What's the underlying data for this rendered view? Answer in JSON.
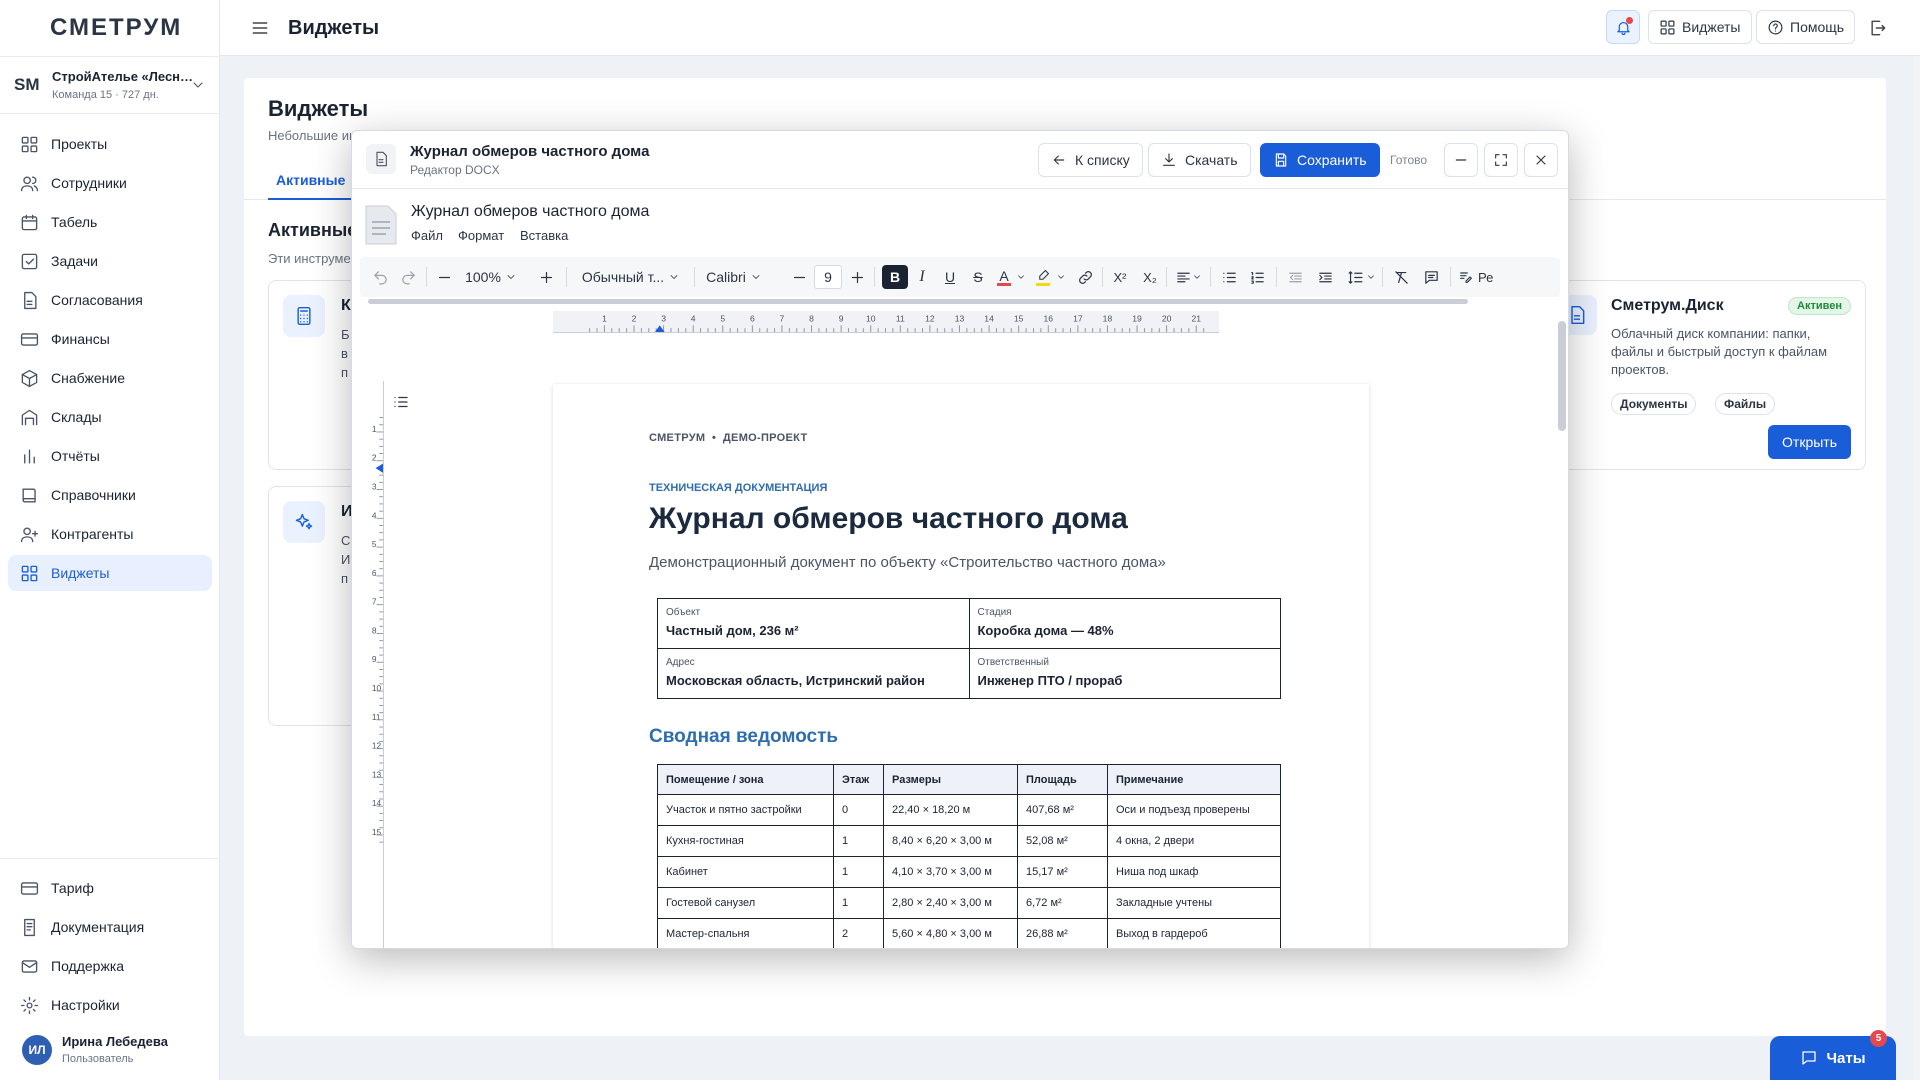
{
  "sidebar": {
    "logo": "СМЕТРУМ",
    "org_logo": "SM",
    "org_name": "СтройАтелье «Лесн…",
    "org_sub": "Команда 15 · 727 дн.",
    "items": [
      {
        "label": "Проекты",
        "icon": "grid-icon"
      },
      {
        "label": "Сотрудники",
        "icon": "users-icon"
      },
      {
        "label": "Табель",
        "icon": "calendar-icon"
      },
      {
        "label": "Задачи",
        "icon": "check-square-icon"
      },
      {
        "label": "Согласования",
        "icon": "file-icon"
      },
      {
        "label": "Финансы",
        "icon": "card-icon"
      },
      {
        "label": "Снабжение",
        "icon": "box-icon"
      },
      {
        "label": "Склады",
        "icon": "warehouse-icon"
      },
      {
        "label": "Отчёты",
        "icon": "bar-chart-icon"
      },
      {
        "label": "Справочники",
        "icon": "book-icon"
      },
      {
        "label": "Контрагенты",
        "icon": "user-plus-icon"
      },
      {
        "label": "Виджеты",
        "icon": "grid-icon"
      }
    ],
    "bottom_items": [
      {
        "label": "Тариф",
        "icon": "card-icon"
      },
      {
        "label": "Документация",
        "icon": "doc-icon"
      },
      {
        "label": "Поддержка",
        "icon": "mail-icon"
      },
      {
        "label": "Настройки",
        "icon": "gear-icon"
      }
    ],
    "user": {
      "initials": "ИЛ",
      "name": "Ирина Лебедева",
      "role": "Пользователь"
    }
  },
  "header": {
    "title": "Виджеты",
    "widgets_btn": "Виджеты",
    "help_btn": "Помощь"
  },
  "page": {
    "title": "Виджеты",
    "subtitle": "Небольшие ин",
    "tab_active": "Активные",
    "section_title": "Активные",
    "section_sub": "Эти инструме",
    "card1_letter": "К",
    "card1_desc_lines": [
      "Б",
      "в",
      "п"
    ],
    "card2_letter": "И",
    "card2_desc_lines": [
      "С",
      "И",
      "п"
    ],
    "disk": {
      "name": "Сметрум.Диск",
      "badge": "Активен",
      "desc": "Облачный диск компании: папки, файлы и быстрый доступ к файлам проектов.",
      "tags": [
        "Документы",
        "Файлы"
      ],
      "open": "Открыть"
    }
  },
  "modal": {
    "title": "Журнал обмеров частного дома",
    "subtitle": "Редактор DOCX",
    "back_btn": "К списку",
    "download_btn": "Скачать",
    "save_btn": "Сохранить",
    "status": "Готово",
    "doc_title": "Журнал обмеров частного дома",
    "menu": [
      "Файл",
      "Формат",
      "Вставка"
    ],
    "toolbar": {
      "zoom": "100%",
      "style": "Обычный т...",
      "font": "Calibri",
      "size": "9",
      "bold": "B",
      "italic": "I",
      "underline": "U",
      "strike": "S",
      "font_color": "A",
      "superscript": "X²",
      "subscript": "X₂",
      "review": "Ре"
    },
    "ruler_h": [
      "1",
      "2",
      "3",
      "4",
      "5",
      "6",
      "7",
      "8",
      "9",
      "10",
      "11",
      "12",
      "13",
      "14",
      "15",
      "16",
      "17",
      "18",
      "19",
      "20",
      "21"
    ],
    "ruler_v": [
      "1",
      "2",
      "3",
      "4",
      "5",
      "6",
      "7",
      "8",
      "9",
      "10",
      "11",
      "12",
      "13",
      "14",
      "15"
    ]
  },
  "document": {
    "header_left": "СМЕТРУМ",
    "header_sep": "•",
    "header_right": "ДЕМО-ПРОЕКТ",
    "kicker": "ТЕХНИЧЕСКАЯ ДОКУМЕНТАЦИЯ",
    "title": "Журнал обмеров частного дома",
    "lead": "Демонстрационный документ по объекту «Строительство частного дома»",
    "info": [
      [
        {
          "label": "Объект",
          "value": "Частный дом, 236 м²"
        },
        {
          "label": "Стадия",
          "value": "Коробка дома — 48%"
        }
      ],
      [
        {
          "label": "Адрес",
          "value": "Московская область, Истринский район"
        },
        {
          "label": "Ответственный",
          "value": "Инженер ПТО / прораб"
        }
      ]
    ],
    "section": "Сводная ведомость",
    "table_headers": [
      "Помещение / зона",
      "Этаж",
      "Размеры",
      "Площадь",
      "Примечание"
    ],
    "table_rows": [
      [
        "Участок и пятно застройки",
        "0",
        "22,40 × 18,20 м",
        "407,68 м²",
        "Оси и подъезд проверены"
      ],
      [
        "Кухня-гостиная",
        "1",
        "8,40 × 6,20 × 3,00 м",
        "52,08 м²",
        "4 окна, 2 двери"
      ],
      [
        "Кабинет",
        "1",
        "4,10 × 3,70 × 3,00 м",
        "15,17 м²",
        "Ниша под шкаф"
      ],
      [
        "Гостевой санузел",
        "1",
        "2,80 × 2,40 × 3,00 м",
        "6,72 м²",
        "Закладные учтены"
      ],
      [
        "Мастер-спальня",
        "2",
        "5,60 × 4,80 × 3,00 м",
        "26,88 м²",
        "Выход в гардероб"
      ]
    ]
  },
  "chats": {
    "label": "Чаты",
    "badge": "5"
  },
  "colors": {
    "accent": "#1a5dd9",
    "heading_blue": "#2e6db0",
    "badge_red": "#e5484d"
  }
}
